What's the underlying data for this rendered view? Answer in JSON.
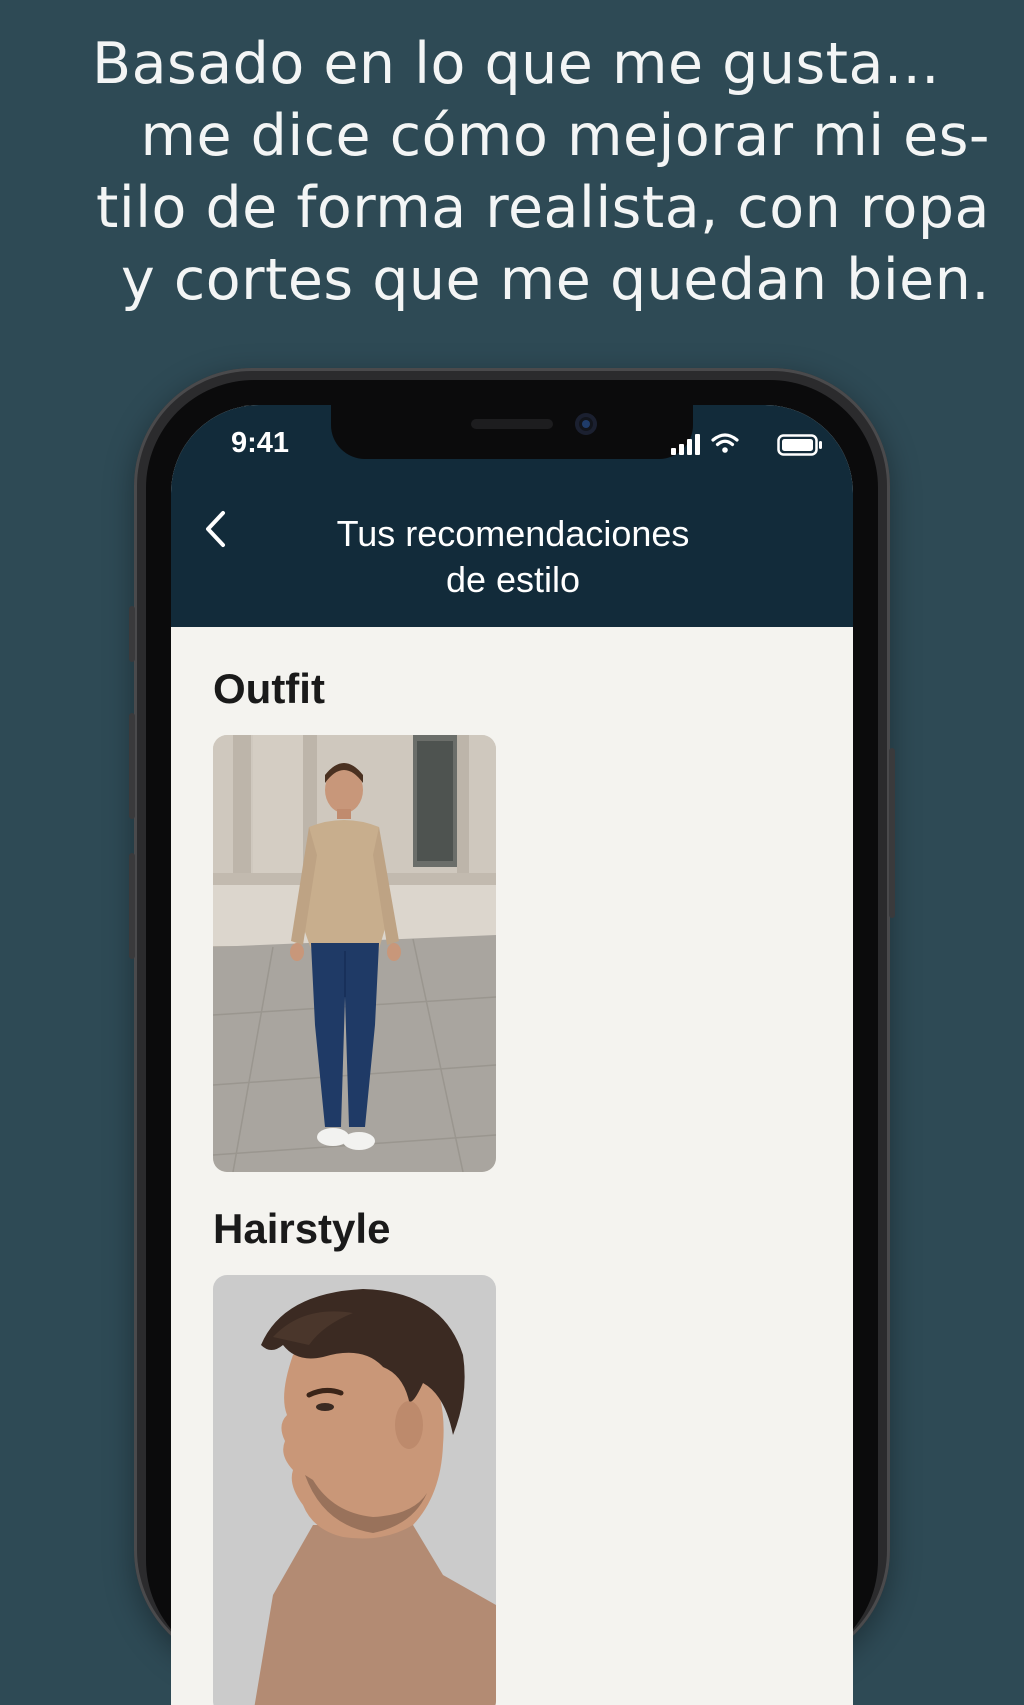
{
  "headline": {
    "lines": [
      "Basado en lo que me gusta...",
      "me dice cómo mejorar mi es-",
      "tilo de forma realista, con ropa",
      "y cortes que me quedan bien."
    ]
  },
  "status_bar": {
    "time": "9:41",
    "icons": [
      "signal-icon",
      "wifi-icon",
      "battery-icon"
    ]
  },
  "nav": {
    "back_icon": "chevron-left-icon",
    "title_lines": [
      "Tus recomendaciones",
      "de estilo"
    ]
  },
  "sections": {
    "outfit": {
      "title": "Outfit",
      "image": "outfit-photo"
    },
    "hairstyle": {
      "title": "Hairstyle",
      "image": "hairstyle-photo"
    }
  },
  "colors": {
    "background": "#2e4a55",
    "nav_bar": "#122b3a",
    "screen_bg": "#f4f3ef"
  }
}
